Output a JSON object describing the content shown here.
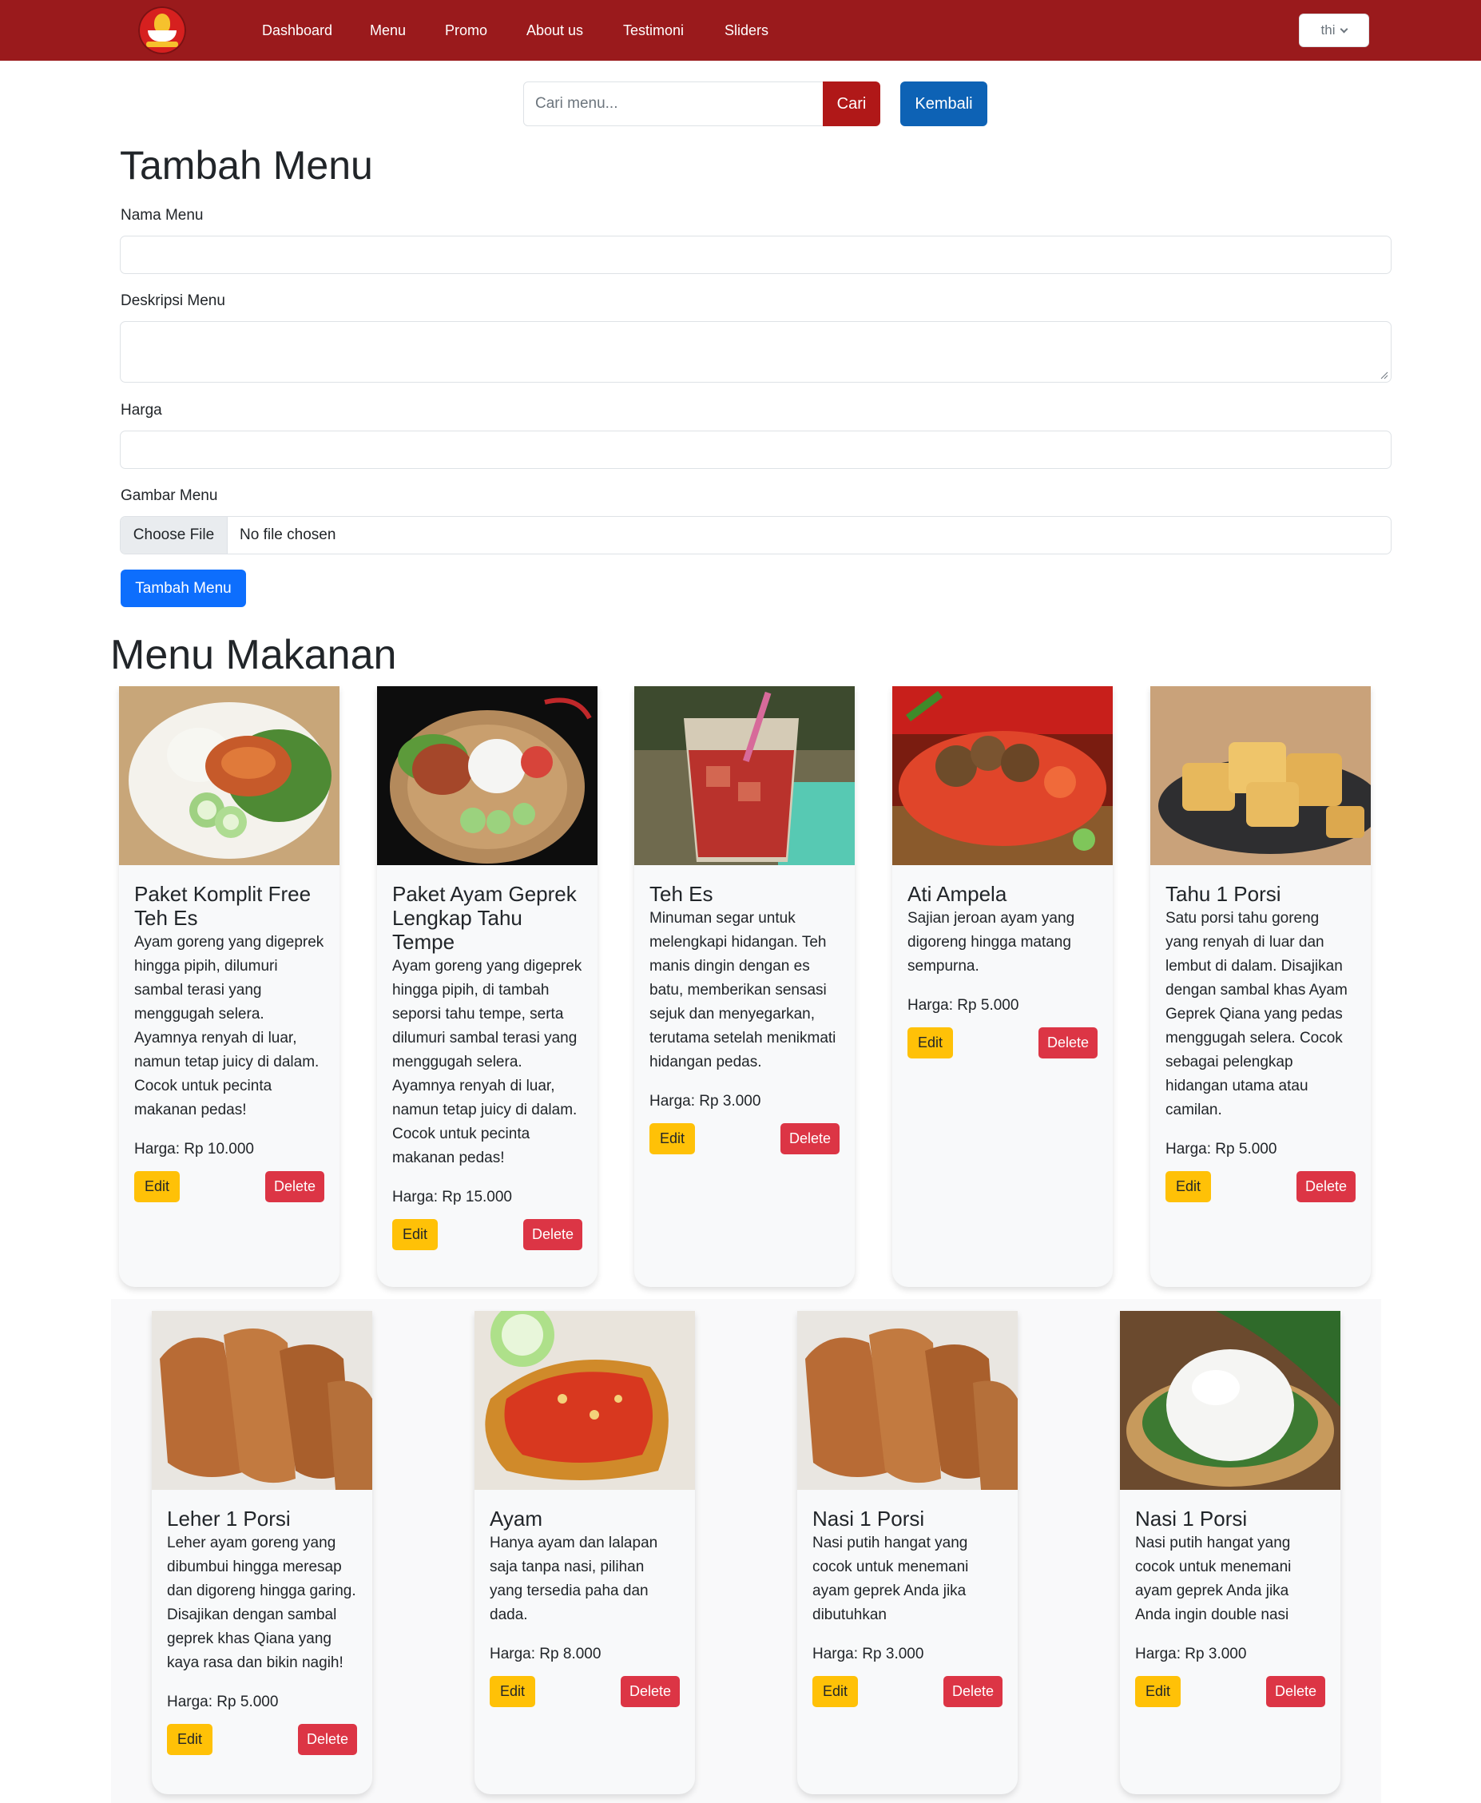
{
  "nav": {
    "links": [
      "Dashboard",
      "Menu",
      "Promo",
      "About us",
      "Testimoni",
      "Sliders"
    ],
    "user_label": "thi"
  },
  "search": {
    "placeholder": "Cari menu...",
    "button_label": "Cari",
    "back_label": "Kembali"
  },
  "form": {
    "title": "Tambah Menu",
    "name_label": "Nama Menu",
    "desc_label": "Deskripsi Menu",
    "price_label": "Harga",
    "image_label": "Gambar Menu",
    "file_button_label": "Choose File",
    "file_status": "No file chosen",
    "submit_label": "Tambah Menu"
  },
  "menu_section": {
    "title": "Menu Makanan",
    "edit_label": "Edit",
    "delete_label": "Delete",
    "items": [
      {
        "name": "Paket Komplit Free Teh Es",
        "description": "Ayam goreng yang digeprek hingga pipih, dilumuri sambal terasi yang menggugah selera. Ayamnya renyah di luar, namun tetap juicy di dalam. Cocok untuk pecinta makanan pedas!",
        "price": "Harga: Rp 10.000"
      },
      {
        "name": "Paket Ayam Geprek Lengkap Tahu Tempe",
        "description": "Ayam goreng yang digeprek hingga pipih, di tambah seporsi tahu tempe, serta dilumuri sambal terasi yang menggugah selera. Ayamnya renyah di luar, namun tetap juicy di dalam. Cocok untuk pecinta makanan pedas!",
        "price": "Harga: Rp 15.000"
      },
      {
        "name": "Teh Es",
        "description": "Minuman segar untuk melengkapi hidangan. Teh manis dingin dengan es batu, memberikan sensasi sejuk dan menyegarkan, terutama setelah menikmati hidangan pedas.",
        "price": "Harga: Rp 3.000"
      },
      {
        "name": "Ati Ampela",
        "description": "Sajian jeroan ayam yang digoreng hingga matang sempurna.",
        "price": "Harga: Rp 5.000"
      },
      {
        "name": "Tahu 1 Porsi",
        "description": "Satu porsi tahu goreng yang renyah di luar dan lembut di dalam. Disajikan dengan sambal khas Ayam Geprek Qiana yang pedas menggugah selera. Cocok sebagai pelengkap hidangan utama atau camilan.",
        "price": "Harga: Rp 5.000"
      },
      {
        "name": "Leher 1 Porsi",
        "description": "Leher ayam goreng yang dibumbui hingga meresap dan digoreng hingga garing. Disajikan dengan sambal geprek khas Qiana yang kaya rasa dan bikin nagih!",
        "price": "Harga: Rp 5.000"
      },
      {
        "name": "Ayam",
        "description": "Hanya ayam dan lalapan saja tanpa nasi, pilihan yang tersedia paha dan dada.",
        "price": "Harga: Rp 8.000"
      },
      {
        "name": "Nasi 1 Porsi",
        "description": "Nasi putih hangat yang cocok untuk menemani ayam geprek Anda jika dibutuhkan",
        "price": "Harga: Rp 3.000"
      },
      {
        "name": "Nasi 1 Porsi",
        "description": "Nasi putih hangat yang cocok untuk menemani ayam geprek Anda jika Anda ingin double nasi",
        "price": "Harga: Rp 3.000"
      }
    ]
  }
}
